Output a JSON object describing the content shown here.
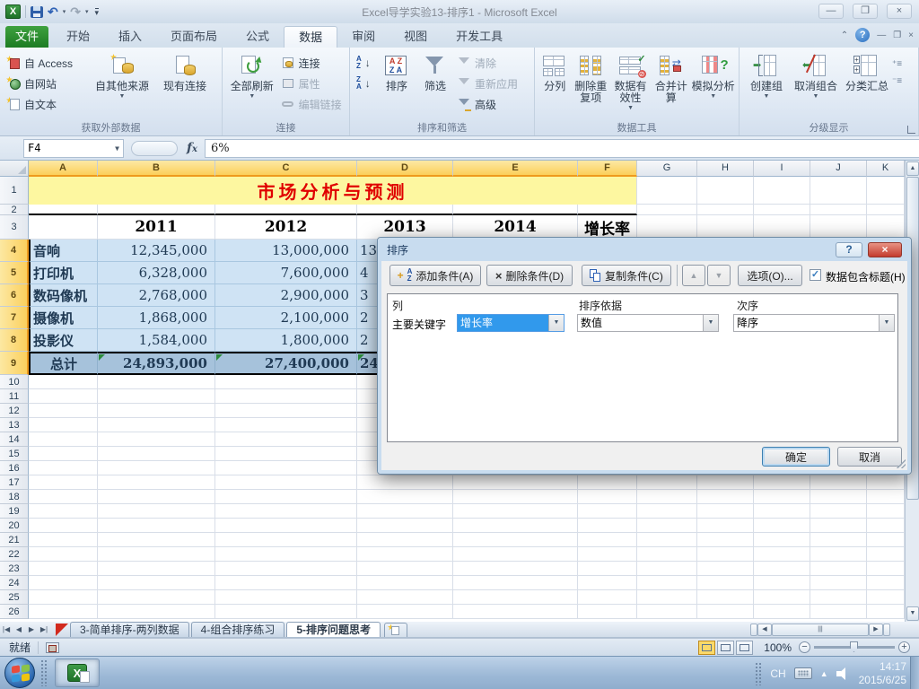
{
  "titlebar": {
    "title": "Excel导学实验13-排序1 - Microsoft Excel"
  },
  "ribbon": {
    "file_tab": "文件",
    "tabs": [
      "开始",
      "插入",
      "页面布局",
      "公式",
      "数据",
      "审阅",
      "视图",
      "开发工具"
    ],
    "active_tab": "数据",
    "external": {
      "label": "获取外部数据",
      "access": "自 Access",
      "web": "自网站",
      "text": "自文本",
      "other": "自其他来源",
      "existing": "现有连接"
    },
    "connections": {
      "label": "连接",
      "refresh_all": "全部刷新",
      "conn": "连接",
      "properties": "属性",
      "edit_links": "编辑链接"
    },
    "sort_filter": {
      "label": "排序和筛选",
      "sort": "排序",
      "filter": "筛选",
      "clear": "清除",
      "reapply": "重新应用",
      "advanced": "高级"
    },
    "data_tools": {
      "label": "数据工具",
      "text_to_columns": "分列",
      "remove_duplicates": "删除重复项",
      "validation": "数据有效性",
      "consolidate": "合并计算",
      "what_if": "模拟分析"
    },
    "outline": {
      "label": "分级显示",
      "group": "创建组",
      "ungroup": "取消组合",
      "subtotal": "分类汇总"
    }
  },
  "formula_bar": {
    "name_box": "F4",
    "value": "6%"
  },
  "grid": {
    "columns": [
      "A",
      "B",
      "C",
      "D",
      "E",
      "F",
      "G",
      "H",
      "I",
      "J",
      "K"
    ],
    "rows_123": [
      "1",
      "2",
      "3"
    ],
    "banner": "市场分析与预测",
    "year_headers": [
      "2011",
      "2012",
      "2013",
      "2014"
    ],
    "growth_header": "增长率",
    "rows": [
      {
        "n": "4",
        "label": "音响",
        "y2011": "12,345,000",
        "y2012": "13,000,000",
        "y2013_partial": "13"
      },
      {
        "n": "5",
        "label": "打印机",
        "y2011": "6,328,000",
        "y2012": "7,600,000",
        "y2013_partial": "4"
      },
      {
        "n": "6",
        "label": "数码像机",
        "y2011": "2,768,000",
        "y2012": "2,900,000",
        "y2013_partial": "3"
      },
      {
        "n": "7",
        "label": "摄像机",
        "y2011": "1,868,000",
        "y2012": "2,100,000",
        "y2013_partial": "2"
      },
      {
        "n": "8",
        "label": "投影仪",
        "y2011": "1,584,000",
        "y2012": "1,800,000",
        "y2013_partial": "2"
      }
    ],
    "total": {
      "n": "9",
      "label": "总计",
      "y2011": "24,893,000",
      "y2012": "27,400,000",
      "y2013_partial": "24"
    },
    "empty_row_numbers": [
      10,
      11,
      12,
      13,
      14,
      15,
      16,
      17,
      18,
      19,
      20,
      21,
      22,
      23,
      24,
      25,
      26
    ]
  },
  "sort_dialog": {
    "title": "排序",
    "add": "添加条件(A)",
    "delete": "删除条件(D)",
    "copy": "复制条件(C)",
    "options": "选项(O)...",
    "header_checkbox": "数据包含标题(H)",
    "col_header": "列",
    "sort_on_header": "排序依据",
    "order_header": "次序",
    "key_label": "主要关键字",
    "key_value": "增长率",
    "sort_on_value": "数值",
    "order_value": "降序",
    "ok": "确定",
    "cancel": "取消"
  },
  "sheet_tabs": {
    "tab1": "3-简单排序-两列数据",
    "tab2": "4-组合排序练习",
    "tab3": "5-排序问题思考"
  },
  "status_bar": {
    "ready": "就绪",
    "zoom": "100%"
  },
  "taskbar": {
    "lang": "CH",
    "time": "14:17",
    "date": "2015/6/25"
  }
}
